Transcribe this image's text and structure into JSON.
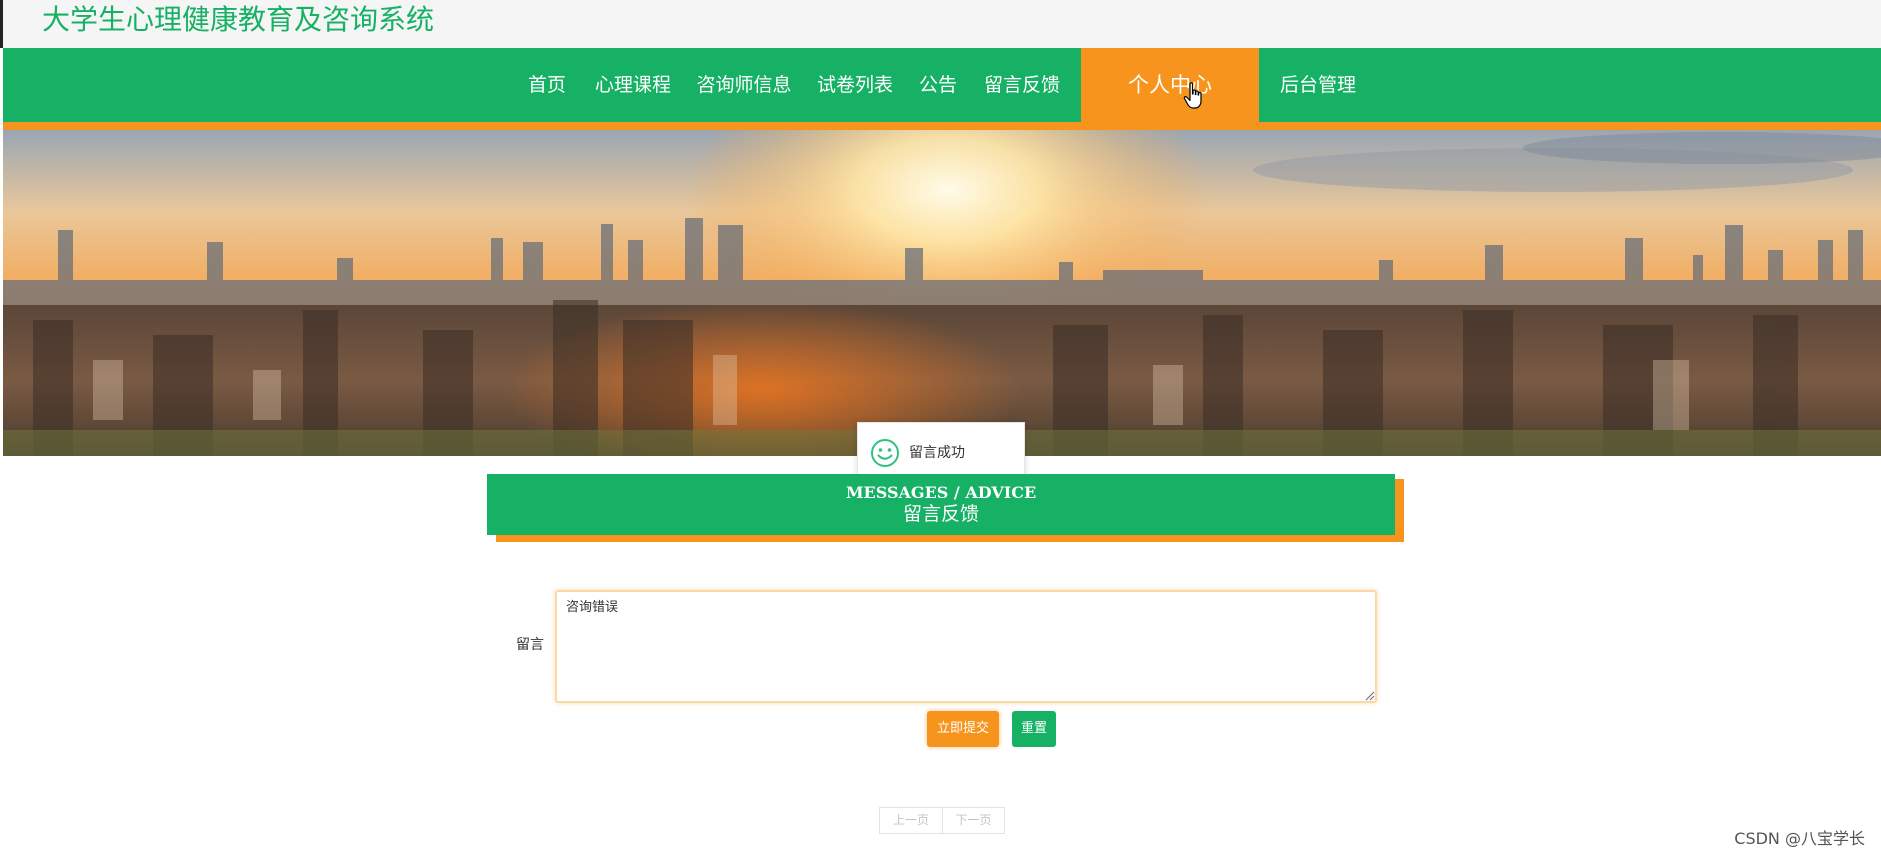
{
  "site": {
    "title": "大学生心理健康教育及咨询系统"
  },
  "nav": {
    "items": [
      {
        "label": "首页"
      },
      {
        "label": "心理课程"
      },
      {
        "label": "咨询师信息"
      },
      {
        "label": "试卷列表"
      },
      {
        "label": "公告"
      },
      {
        "label": "留言反馈"
      },
      {
        "label": "个人中心",
        "active": true
      },
      {
        "label": "后台管理"
      }
    ]
  },
  "toast": {
    "icon": "smile-icon",
    "message": "留言成功"
  },
  "section": {
    "title_en": "MESSAGES / ADVICE",
    "title_zh": "留言反馈"
  },
  "form": {
    "message_label": "留言",
    "message_value": "咨询错误",
    "submit_label": "立即提交",
    "reset_label": "重置"
  },
  "pager": {
    "prev_label": "上一页",
    "next_label": "下一页"
  },
  "watermark": "CSDN @八宝学长",
  "colors": {
    "primary_green": "#16b165",
    "accent_orange": "#f7941d"
  }
}
